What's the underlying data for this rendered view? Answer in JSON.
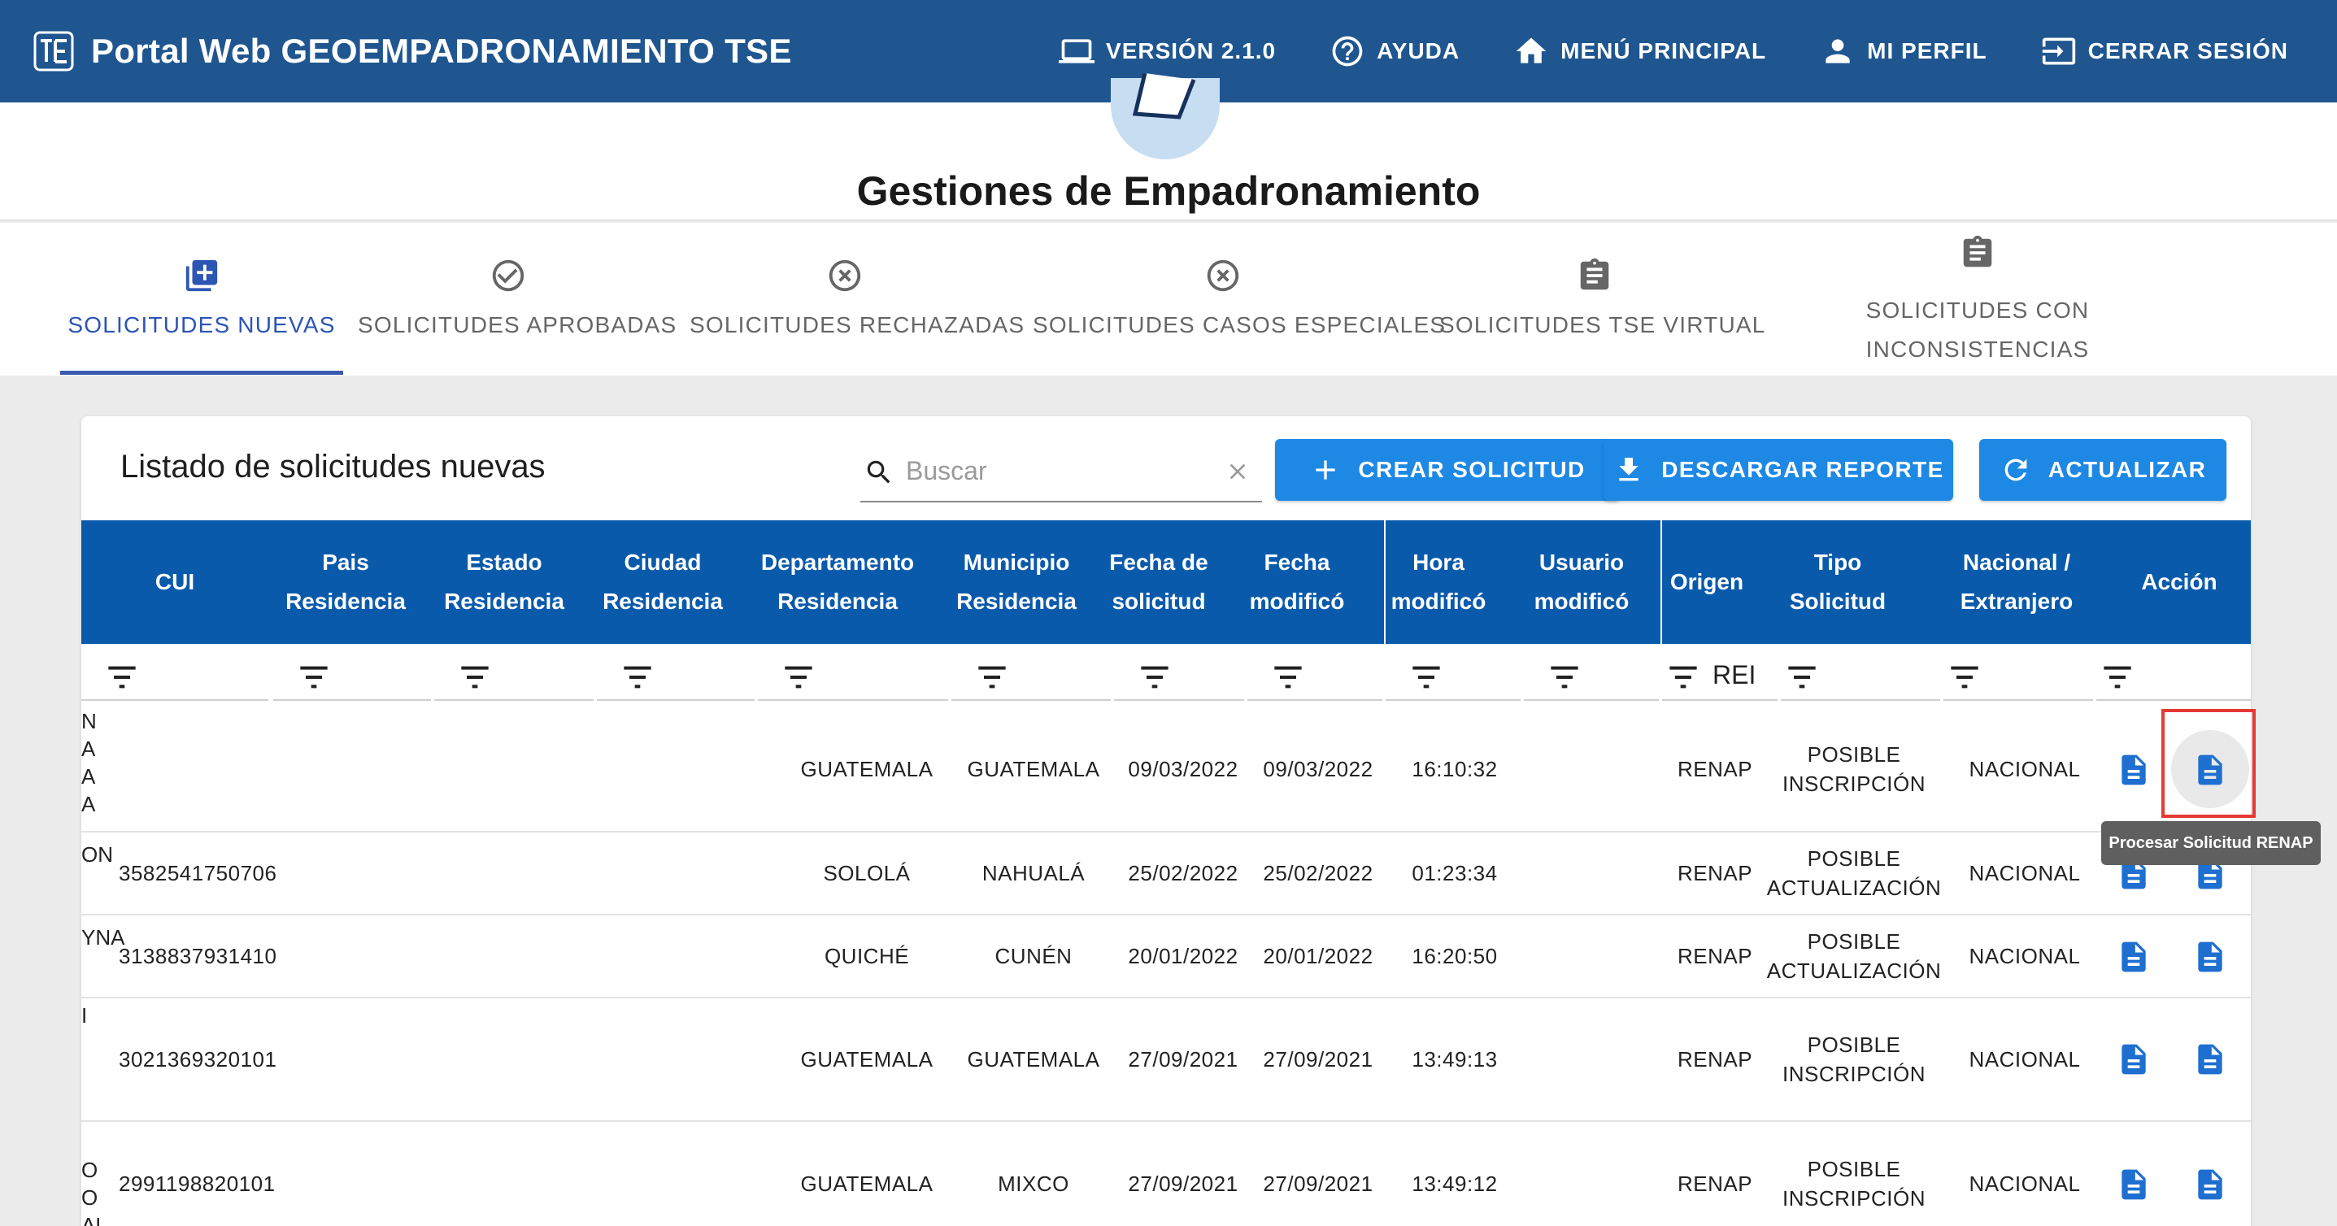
{
  "appbar": {
    "title": "Portal Web GEOEMPADRONAMIENTO TSE",
    "nav": [
      {
        "label": "VERSIÓN 2.1.0",
        "icon": "laptop-icon"
      },
      {
        "label": "AYUDA",
        "icon": "help-icon"
      },
      {
        "label": "MENÚ PRINCIPAL",
        "icon": "home-icon"
      },
      {
        "label": "MI PERFIL",
        "icon": "person-icon"
      },
      {
        "label": "CERRAR SESIÓN",
        "icon": "logout-icon"
      }
    ]
  },
  "page": {
    "title": "Gestiones de Empadronamiento"
  },
  "tabs": [
    {
      "label": "SOLICITUDES NUEVAS",
      "icon": "add-box-icon",
      "active": true
    },
    {
      "label": "SOLICITUDES APROBADAS",
      "icon": "check-circle-icon"
    },
    {
      "label": "SOLICITUDES RECHAZADAS",
      "icon": "cancel-circle-icon"
    },
    {
      "label": "SOLICITUDES CASOS ESPECIALES",
      "icon": "cancel-circle-icon"
    },
    {
      "label": "SOLICITUDES TSE VIRTUAL",
      "icon": "clipboard-icon"
    },
    {
      "label": "SOLICITUDES CON INCONSISTENCIAS",
      "icon": "clipboard-icon"
    }
  ],
  "list": {
    "title": "Listado de solicitudes nuevas",
    "search_placeholder": "Buscar",
    "buttons": {
      "crear": "CREAR SOLICITUD",
      "descargar": "DESCARGAR REPORTE",
      "actualizar": "ACTUALIZAR"
    }
  },
  "table": {
    "columns": [
      {
        "key": "cui",
        "label": "CUI"
      },
      {
        "key": "pais",
        "label": "Pais Residencia"
      },
      {
        "key": "estado",
        "label": "Estado Residencia"
      },
      {
        "key": "ciudad",
        "label": "Ciudad Residencia"
      },
      {
        "key": "departamento",
        "label": "Departamento Residencia"
      },
      {
        "key": "municipio",
        "label": "Municipio Residencia"
      },
      {
        "key": "fecha_solicitud",
        "label": "Fecha de solicitud"
      },
      {
        "key": "fecha_modifico",
        "label": "Fecha modificó"
      },
      {
        "key": "hora",
        "label": "Hora modificó"
      },
      {
        "key": "usuario",
        "label": "Usuario modificó"
      },
      {
        "key": "origen",
        "label": "Origen"
      },
      {
        "key": "tipo",
        "label": "Tipo Solicitud"
      },
      {
        "key": "nacional",
        "label": "Nacional / Extranjero"
      },
      {
        "key": "accion",
        "label": "Acción"
      }
    ],
    "origen_filter_value": "REI",
    "rows": [
      {
        "frag": "N\nA\nA\nA",
        "cui": "",
        "departamento": "GUATEMALA",
        "municipio": "GUATEMALA",
        "fecha_solicitud": "09/03/2022",
        "fecha_modifico": "09/03/2022",
        "hora": "16:10:32",
        "origen": "RENAP",
        "tipo": "POSIBLE INSCRIPCIÓN",
        "nacional": "NACIONAL"
      },
      {
        "frag": "ON",
        "cui": "3582541750706",
        "departamento": "SOLOLÁ",
        "municipio": "NAHUALÁ",
        "fecha_solicitud": "25/02/2022",
        "fecha_modifico": "25/02/2022",
        "hora": "01:23:34",
        "origen": "RENAP",
        "tipo": "POSIBLE ACTUALIZACIÓN",
        "nacional": "NACIONAL"
      },
      {
        "frag": "YNA",
        "cui": "3138837931410",
        "departamento": "QUICHÉ",
        "municipio": "CUNÉN",
        "fecha_solicitud": "20/01/2022",
        "fecha_modifico": "20/01/2022",
        "hora": "16:20:50",
        "origen": "RENAP",
        "tipo": "POSIBLE ACTUALIZACIÓN",
        "nacional": "NACIONAL"
      },
      {
        "frag": "I",
        "cui": "3021369320101",
        "departamento": "GUATEMALA",
        "municipio": "GUATEMALA",
        "fecha_solicitud": "27/09/2021",
        "fecha_modifico": "27/09/2021",
        "hora": "13:49:13",
        "origen": "RENAP",
        "tipo": "POSIBLE INSCRIPCIÓN",
        "nacional": "NACIONAL"
      },
      {
        "frag": "O\nO\nAL",
        "cui": "2991198820101",
        "departamento": "GUATEMALA",
        "municipio": "MIXCO",
        "fecha_solicitud": "27/09/2021",
        "fecha_modifico": "27/09/2021",
        "hora": "13:49:12",
        "origen": "RENAP",
        "tipo": "POSIBLE INSCRIPCIÓN",
        "nacional": "NACIONAL"
      }
    ]
  },
  "tooltip": {
    "text": "Procesar Solicitud RENAP"
  },
  "colors": {
    "appbar": "#1f5690",
    "table_header": "#0a5aac",
    "button": "#1e88e5",
    "action_icon": "#1e6fd0",
    "active_tab": "#2c55b4",
    "highlight": "#e53935"
  }
}
